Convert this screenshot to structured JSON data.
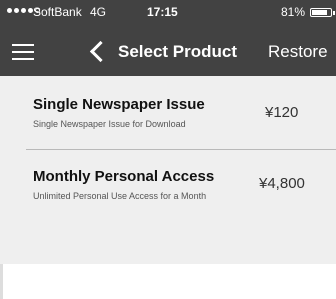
{
  "status_bar": {
    "carrier": "SoftBank",
    "network": "4G",
    "time": "17:15",
    "battery": "81%",
    "battery_level": 0.81
  },
  "nav": {
    "title": "Select Product",
    "restore_label": "Restore",
    "menu_icon": "hamburger-menu-icon",
    "back_icon": "chevron-left-icon"
  },
  "products": [
    {
      "title": "Single Newspaper Issue",
      "description": "Single Newspaper Issue for Download",
      "price": "¥120"
    },
    {
      "title": "Monthly Personal Access",
      "description": "Unlimited Personal Use Access for a Month",
      "price": "¥4,800"
    }
  ],
  "colors": {
    "topbar": "#424242",
    "list_background": "#efefef"
  }
}
